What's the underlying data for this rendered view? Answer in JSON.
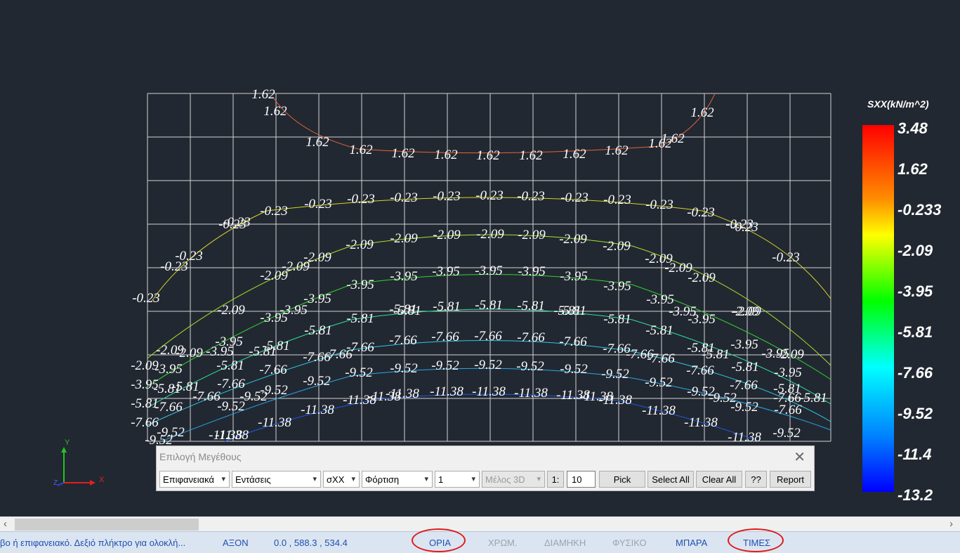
{
  "axis_triad": {
    "y": "Y",
    "x": "X",
    "z": "Z"
  },
  "legend": {
    "title": "SXX(kN/m^2)",
    "ticks": [
      "3.48",
      "1.62",
      "-0.233",
      "-2.09",
      "-3.95",
      "-5.81",
      "-7.66",
      "-9.52",
      "-11.4",
      "-13.2"
    ]
  },
  "contours": [
    {
      "value": "1.62",
      "color": "#e2663a",
      "labels": [
        [
          375,
          140
        ],
        [
          392,
          164
        ],
        [
          452,
          208
        ],
        [
          514,
          219
        ],
        [
          574,
          224
        ],
        [
          635,
          226
        ],
        [
          695,
          227
        ],
        [
          756,
          227
        ],
        [
          818,
          225
        ],
        [
          878,
          220
        ],
        [
          940,
          210
        ],
        [
          958,
          203
        ],
        [
          1000,
          166
        ]
      ]
    },
    {
      "value": "-0.23",
      "color": "#d4d42a",
      "labels": [
        [
          208,
          430
        ],
        [
          248,
          385
        ],
        [
          269,
          370
        ],
        [
          331,
          325
        ],
        [
          337,
          322
        ],
        [
          390,
          306
        ],
        [
          453,
          296
        ],
        [
          514,
          289
        ],
        [
          575,
          287
        ],
        [
          636,
          285
        ],
        [
          697,
          284
        ],
        [
          756,
          285
        ],
        [
          818,
          287
        ],
        [
          879,
          290
        ],
        [
          939,
          297
        ],
        [
          998,
          308
        ],
        [
          1053,
          325
        ],
        [
          1060,
          329
        ],
        [
          1119,
          372
        ]
      ]
    },
    {
      "value": "-2.09",
      "color": "#a6e22a",
      "labels": [
        [
          206,
          526
        ],
        [
          242,
          504
        ],
        [
          269,
          508
        ],
        [
          329,
          447
        ],
        [
          390,
          398
        ],
        [
          421,
          385
        ],
        [
          452,
          372
        ],
        [
          512,
          354
        ],
        [
          575,
          345
        ],
        [
          636,
          340
        ],
        [
          698,
          339
        ],
        [
          757,
          340
        ],
        [
          816,
          346
        ],
        [
          878,
          356
        ],
        [
          938,
          374
        ],
        [
          966,
          387
        ],
        [
          999,
          401
        ],
        [
          1061,
          449
        ],
        [
          1064,
          449
        ],
        [
          1125,
          510
        ]
      ]
    },
    {
      "value": "-3.95",
      "color": "#32d232",
      "labels": [
        [
          206,
          553
        ],
        [
          240,
          531
        ],
        [
          326,
          492
        ],
        [
          313,
          506
        ],
        [
          390,
          458
        ],
        [
          418,
          447
        ],
        [
          452,
          431
        ],
        [
          513,
          411
        ],
        [
          575,
          399
        ],
        [
          635,
          392
        ],
        [
          696,
          391
        ],
        [
          757,
          392
        ],
        [
          817,
          399
        ],
        [
          879,
          413
        ],
        [
          940,
          432
        ],
        [
          972,
          449
        ],
        [
          999,
          460
        ],
        [
          1060,
          496
        ],
        [
          1104,
          509
        ],
        [
          1122,
          536
        ]
      ]
    },
    {
      "value": "-5.81",
      "color": "#2ee0a0",
      "labels": [
        [
          206,
          580
        ],
        [
          238,
          559
        ],
        [
          264,
          556
        ],
        [
          328,
          526
        ],
        [
          374,
          506
        ],
        [
          393,
          498
        ],
        [
          453,
          476
        ],
        [
          513,
          459
        ],
        [
          580,
          448
        ],
        [
          574,
          446
        ],
        [
          636,
          442
        ],
        [
          696,
          440
        ],
        [
          756,
          441
        ],
        [
          815,
          448
        ],
        [
          808,
          448
        ],
        [
          879,
          460
        ],
        [
          939,
          476
        ],
        [
          998,
          501
        ],
        [
          1019,
          510
        ],
        [
          1061,
          528
        ],
        [
          1121,
          559
        ],
        [
          1158,
          572
        ]
      ]
    },
    {
      "value": "-7.66",
      "color": "#2ec8e6",
      "labels": [
        [
          206,
          607
        ],
        [
          240,
          585
        ],
        [
          294,
          570
        ],
        [
          329,
          552
        ],
        [
          389,
          532
        ],
        [
          451,
          514
        ],
        [
          482,
          510
        ],
        [
          513,
          500
        ],
        [
          574,
          490
        ],
        [
          634,
          485
        ],
        [
          695,
          484
        ],
        [
          756,
          486
        ],
        [
          816,
          492
        ],
        [
          878,
          502
        ],
        [
          911,
          510
        ],
        [
          941,
          516
        ],
        [
          997,
          533
        ],
        [
          1059,
          554
        ],
        [
          1121,
          572
        ],
        [
          1122,
          589
        ]
      ]
    },
    {
      "value": "-9.52",
      "color": "#28a6e8",
      "labels": [
        [
          226,
          632
        ],
        [
          243,
          621
        ],
        [
          329,
          584
        ],
        [
          361,
          570
        ],
        [
          390,
          561
        ],
        [
          451,
          548
        ],
        [
          511,
          536
        ],
        [
          575,
          530
        ],
        [
          634,
          526
        ],
        [
          695,
          525
        ],
        [
          755,
          527
        ],
        [
          817,
          531
        ],
        [
          876,
          538
        ],
        [
          938,
          550
        ],
        [
          998,
          563
        ],
        [
          1029,
          572
        ],
        [
          1060,
          585
        ],
        [
          1120,
          622
        ]
      ]
    },
    {
      "value": "-11.38",
      "color": "#1e5ae6",
      "labels": [
        [
          321,
          625
        ],
        [
          330,
          625
        ],
        [
          391,
          607
        ],
        [
          452,
          589
        ],
        [
          512,
          575
        ],
        [
          547,
          570
        ],
        [
          573,
          566
        ],
        [
          636,
          563
        ],
        [
          696,
          563
        ],
        [
          756,
          565
        ],
        [
          816,
          568
        ],
        [
          849,
          570
        ],
        [
          876,
          575
        ],
        [
          938,
          590
        ],
        [
          998,
          607
        ],
        [
          1060,
          628
        ]
      ]
    }
  ],
  "dialog": {
    "title": "Επιλογή Μεγέθους",
    "close_glyph": "✕",
    "combos": [
      "Επιφανειακά",
      "Εντάσεις",
      "σXX",
      "Φόρτιση",
      "1",
      "Μέλος 3D"
    ],
    "step_label": "1:",
    "step_value": "10",
    "buttons": {
      "pick": "Pick",
      "select_all": "Select All",
      "clear_all": "Clear All",
      "help": "??",
      "report": "Report"
    }
  },
  "status": {
    "hint": "βο ή επιφανειακό. Δεξιό πλήκτρο για ολοκλή...",
    "axon": "ΑΞΟΝ",
    "coords": "0.0 , 588.3 , 534.4",
    "oria": "ΟΡΙΑ",
    "xrom": "ΧΡΩΜ.",
    "diamikh": "ΔΙΑΜΗΚΗ",
    "fysiko": "ΦΥΣΙΚΟ",
    "mpara": "ΜΠΑΡΑ",
    "times": "ΤΙΜΕΣ"
  },
  "colors": {
    "background": "#222831",
    "grid": "#d2d2d2",
    "highlight_circle": "#e01919"
  }
}
